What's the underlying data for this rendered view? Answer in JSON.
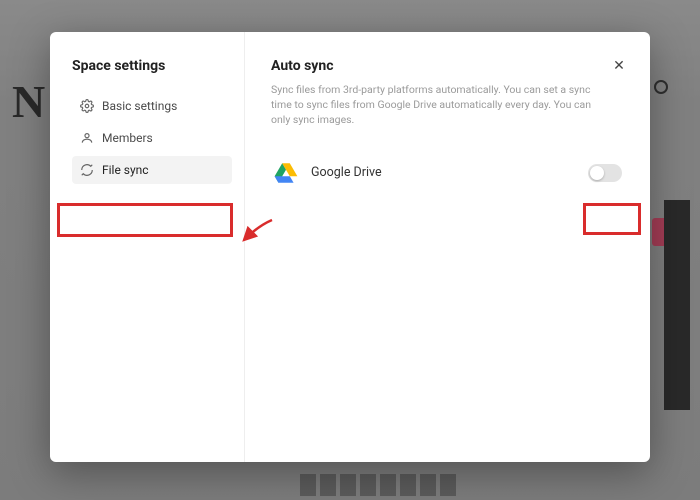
{
  "sidebar": {
    "title": "Space settings",
    "items": [
      {
        "label": "Basic settings"
      },
      {
        "label": "Members"
      },
      {
        "label": "File sync"
      }
    ]
  },
  "main": {
    "title": "Auto sync",
    "description": "Sync files from 3rd-party platforms automatically. You can set a sync time to sync files from Google Drive automatically every day. You can only sync images.",
    "provider": {
      "name": "Google Drive"
    }
  },
  "close_label": "✕"
}
